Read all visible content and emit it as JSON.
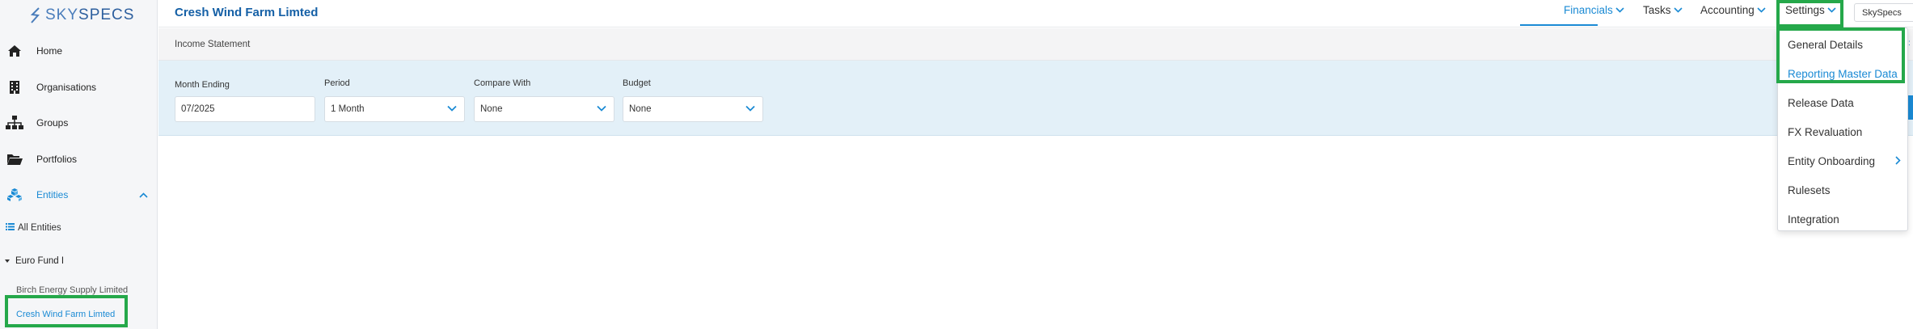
{
  "brand": {
    "logo_text_1": "SKY",
    "logo_text_2": "SPECS"
  },
  "sidebar": {
    "items": [
      {
        "label": "Home",
        "icon": "home-icon"
      },
      {
        "label": "Organisations",
        "icon": "building-icon"
      },
      {
        "label": "Groups",
        "icon": "hierarchy-icon"
      },
      {
        "label": "Portfolios",
        "icon": "folder-open-icon"
      },
      {
        "label": "Entities",
        "icon": "cubes-icon"
      }
    ],
    "all_entities": "All Entities",
    "fund": "Euro Fund I",
    "entities": [
      "Birch Energy Supply Limited",
      "Cresh Wind Farm Limted"
    ]
  },
  "header": {
    "title": "Cresh Wind Farm Limted",
    "nav": [
      "Financials",
      "Tasks",
      "Accounting",
      "Settings"
    ],
    "org_selector": "SkySpecs"
  },
  "breadcrumb": "Income Statement",
  "filters": {
    "month_ending": {
      "label": "Month Ending",
      "value": "07/2025"
    },
    "period": {
      "label": "Period",
      "value": "1 Month"
    },
    "compare_with": {
      "label": "Compare With",
      "value": "None"
    },
    "budget": {
      "label": "Budget",
      "value": "None"
    }
  },
  "settings_menu": {
    "items": [
      "General Details",
      "Reporting Master Data",
      "Release Data",
      "FX Revaluation",
      "Entity Onboarding",
      "Rulesets",
      "Integration"
    ]
  },
  "colors": {
    "accent": "#1a8ad4",
    "title": "#1560a6",
    "highlight": "#25a84a",
    "filter_bg": "#e3f0f8"
  }
}
